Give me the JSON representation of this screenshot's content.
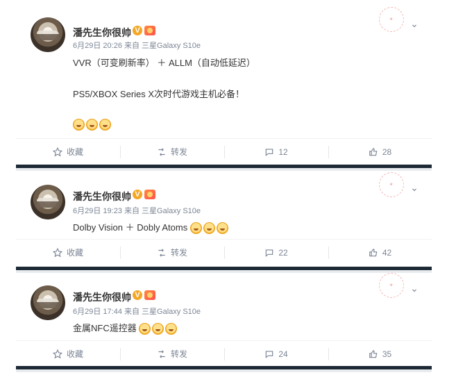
{
  "posts": [
    {
      "author": "潘先生你很帅",
      "verified_badge": "V",
      "meta": "6月29日 20:26 来自 三星Galaxy S10e",
      "lines": [
        "VVR（可变刷新率） ＋ ALLM（自动低延迟）",
        "PS5/XBOX Series X次时代游戏主机必备！"
      ],
      "emoji_count": 3,
      "actions": {
        "favorite": "收藏",
        "repost": "转发",
        "comment_count": "12",
        "like_count": "28"
      }
    },
    {
      "author": "潘先生你很帅",
      "verified_badge": "V",
      "meta": "6月29日 19:23 来自 三星Galaxy S10e",
      "lines": [
        "Dolby Vision ＋ Dobly Atoms"
      ],
      "emoji_count": 3,
      "actions": {
        "favorite": "收藏",
        "repost": "转发",
        "comment_count": "22",
        "like_count": "42"
      }
    },
    {
      "author": "潘先生你很帅",
      "verified_badge": "V",
      "meta": "6月29日 17:44 来自 三星Galaxy S10e",
      "lines": [
        "金属NFC遥控器"
      ],
      "emoji_count": 3,
      "actions": {
        "favorite": "收藏",
        "repost": "转发",
        "comment_count": "24",
        "like_count": "35"
      }
    }
  ],
  "icons": {
    "avatar": "avatar-image",
    "favorite": "star-outline-icon",
    "repost": "repost-icon",
    "comment": "comment-icon",
    "like": "thumbs-up-icon",
    "more": "chevron-down-icon",
    "emoji": "smile-emoji-icon",
    "stamp": "watermark-stamp"
  },
  "colors": {
    "text": "#333333",
    "meta": "#7c8595",
    "separator": "#1d2a36",
    "badge_v": "#f5a623"
  }
}
